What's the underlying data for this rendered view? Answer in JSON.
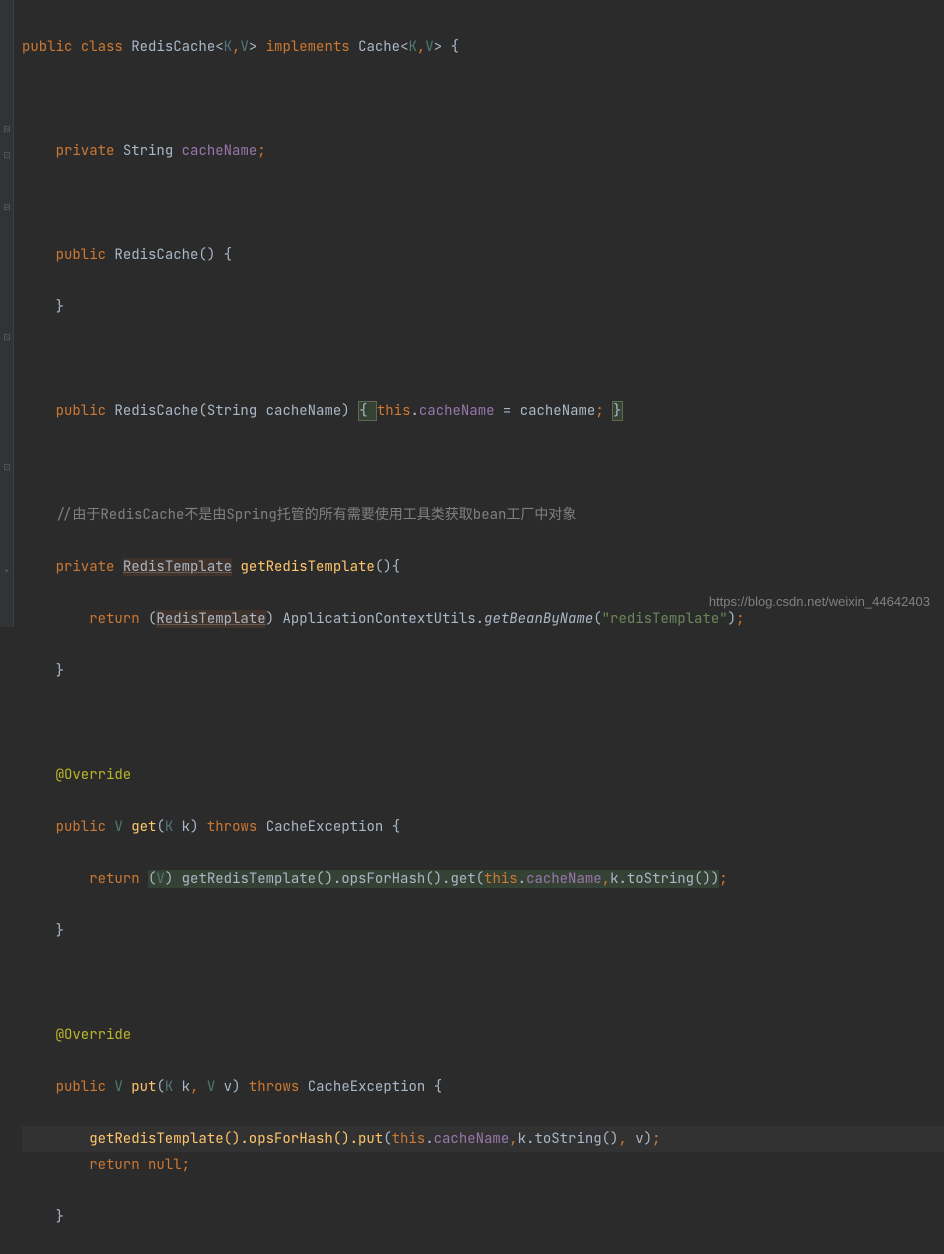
{
  "code": {
    "l1": {
      "kw_public": "public",
      "kw_class": "class",
      "cls": "RedisCache",
      "lt": "<",
      "K": "K",
      "c1": ",",
      "V": "V",
      "gt": ">",
      "kw_impl": "implements",
      "iface": "Cache",
      "lt2": "<",
      "K2": "K",
      "c2": ",",
      "V2": "V",
      "gt2": ">",
      "ob": "{"
    },
    "l2": {
      "kw_private": "private",
      "type": "String",
      "field": "cacheName",
      "sc": ";"
    },
    "l3": {
      "kw_public": "public",
      "ctor": "RedisCache",
      "p": "() {"
    },
    "l4": {
      "cb": "}"
    },
    "l5": {
      "kw_public": "public",
      "ctor": "RedisCache",
      "lp": "(",
      "type": "String",
      "param": "cacheName",
      "rp": ") ",
      "ob": "{ ",
      "kw_this": "this",
      "dot": ".",
      "field": "cacheName",
      "eq": " = ",
      "var": "cacheName",
      "sc": "; ",
      "cb": "}"
    },
    "l6": {
      "comment": "//由于RedisCache不是由Spring托管的所有需要使用工具类获取bean工厂中对象"
    },
    "l7": {
      "kw_private": "private",
      "type": "RedisTemplate",
      "method": "getRedisTemplate",
      "p": "(){"
    },
    "l8": {
      "kw_return": "return",
      "lp": " (",
      "type": "RedisTemplate",
      "rp": ") ",
      "cls": "ApplicationContextUtils",
      "dot": ".",
      "method": "getBeanByName",
      "lp2": "(",
      "str": "\"redisTemplate\"",
      "rp2": ")",
      "sc": ";"
    },
    "l9": {
      "cb": "}"
    },
    "l10": {
      "ann": "@Override"
    },
    "l11": {
      "kw_public": "public",
      "V": "V",
      "method": "get",
      "lp": "(",
      "K": "K",
      "param": " k",
      "rp": ") ",
      "kw_throws": "throws",
      "exc": "CacheException",
      "ob": " {"
    },
    "l12": {
      "kw_return": "return",
      "sp": " ",
      "lp": "(",
      "V": "V",
      "rp": ") ",
      "m1": "getRedisTemplate().opsForHash().get(",
      "kw_this": "this",
      "dot": ".",
      "field": "cacheName",
      "c": ",",
      "m2": "k.toString())",
      "sc": ";"
    },
    "l13": {
      "cb": "}"
    },
    "l14": {
      "ann": "@Override"
    },
    "l15": {
      "kw_public": "public",
      "V": "V",
      "method": "put",
      "lp": "(",
      "K": "K",
      "p1": " k",
      "c1": ", ",
      "V2": "V",
      "p2": " v",
      "rp": ") ",
      "kw_throws": "throws",
      "exc": "CacheException",
      "ob": " {"
    },
    "l16": {
      "m1": "getRedisTemplate().opsForHash().put",
      "lp": "(",
      "kw_this": "this",
      "dot": ".",
      "field": "cacheName",
      "c1": ",",
      "m2": "k.toString()",
      "c2": ", ",
      "v": "v",
      "rp": ")",
      "sc": ";"
    },
    "l17": {
      "kw_return": "return",
      "kw_null": "null",
      "sc": ";"
    },
    "l18": {
      "cb": "}"
    }
  },
  "watermark": "https://blog.csdn.net/weixin_44642403"
}
